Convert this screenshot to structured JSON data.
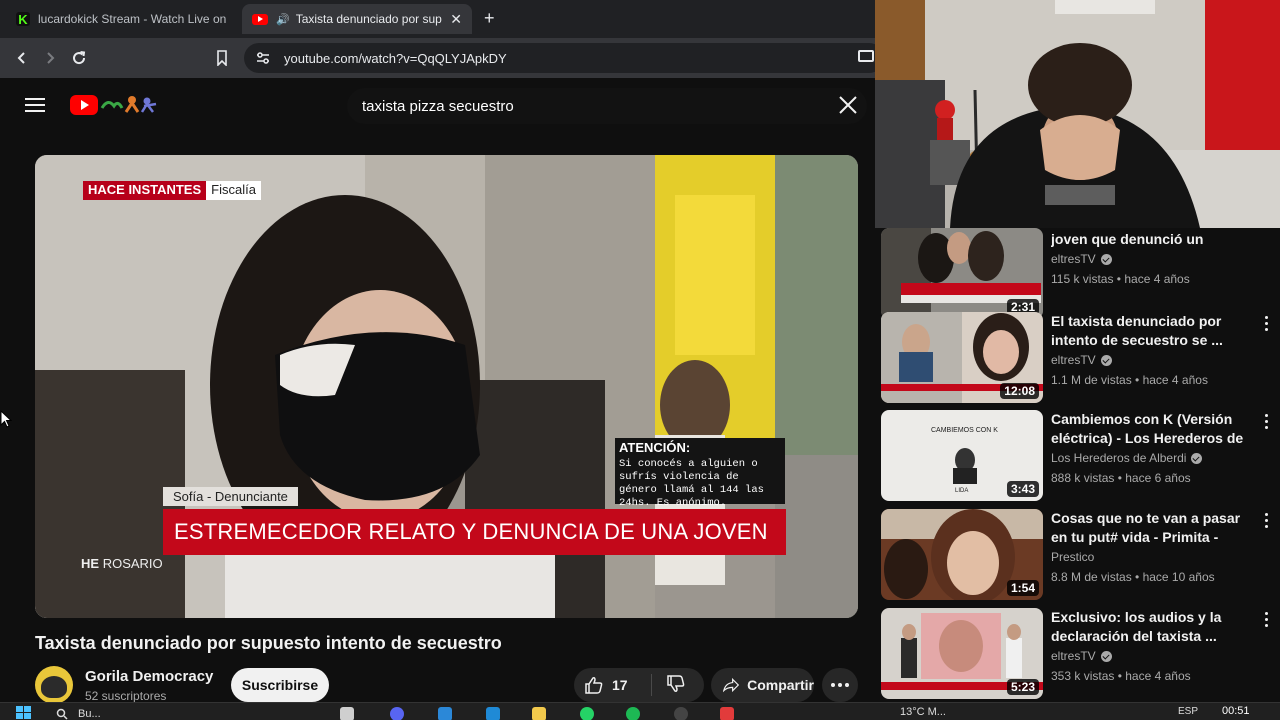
{
  "browser": {
    "tabs": [
      {
        "title": "lucardokick Stream - Watch Live on K",
        "favicon": "kick-icon"
      },
      {
        "title": "Taxista denunciado por supue",
        "favicon": "youtube-icon",
        "audio": true
      }
    ],
    "new_tab": "+",
    "url": "youtube.com/watch?v=QqQLYJApkDY"
  },
  "youtube": {
    "search_query": "taxista pizza secuestro",
    "video": {
      "title": "Taxista denunciado por supuesto intento de secuestro",
      "overlay": {
        "live_label": "HACE INSTANTES",
        "section": "Fiscalía",
        "name_tag": "Sofía - Denunciante",
        "headline": "ESTREMECEDOR RELATO Y DENUNCIA DE UNA JOVEN",
        "alert_title": "ATENCIÓN:",
        "alert_body": "Si conocés a alguien o sufrís violencia de género llamá al 144 las 24hs. Es anónimo.",
        "watermark_a": "HE",
        "watermark_b": "ROSARIO"
      },
      "channel": "Gorila Democracy",
      "subscribers": "52 suscriptores",
      "subscribe_label": "Suscribirse",
      "likes": "17",
      "share_label": "Compartir"
    },
    "recommendations": [
      {
        "title": "joven que denunció un supues...",
        "channel": "eltresTV",
        "verified": true,
        "meta": "115 k vistas • hace 4 años",
        "duration": "2:31"
      },
      {
        "title": "El taxista denunciado por intento de secuestro se ...",
        "channel": "eltresTV",
        "verified": true,
        "meta": "1.1 M de vistas • hace 4 años",
        "duration": "12:08"
      },
      {
        "title": "Cambiemos con K (Versión eléctrica) - Los Herederos de ...",
        "channel": "Los Herederos de Alberdi",
        "verified": true,
        "meta": "888 k vistas • hace 6 años",
        "duration": "3:43",
        "thumb_text": "CAMBIEMOS CON K",
        "thumb_text2": "LIDA"
      },
      {
        "title": "Cosas que no te van a pasar en tu put# vida - Primita - Prestico",
        "channel": "Prestico",
        "verified": false,
        "meta": "8.8 M de vistas • hace 10 años",
        "duration": "1:54"
      },
      {
        "title": "Exclusivo: los audios y la declaración del taxista ...",
        "channel": "eltresTV",
        "verified": true,
        "meta": "353 k vistas • hace 4 años",
        "duration": "5:23"
      }
    ]
  },
  "taskbar": {
    "search_placeholder": "Bu...",
    "weather": "13°C   M...",
    "time": "00:51",
    "lang": "ESP"
  },
  "colors": {
    "youtube_red": "#ff0000",
    "news_red": "#c3081a",
    "background": "#0f0f0f"
  }
}
